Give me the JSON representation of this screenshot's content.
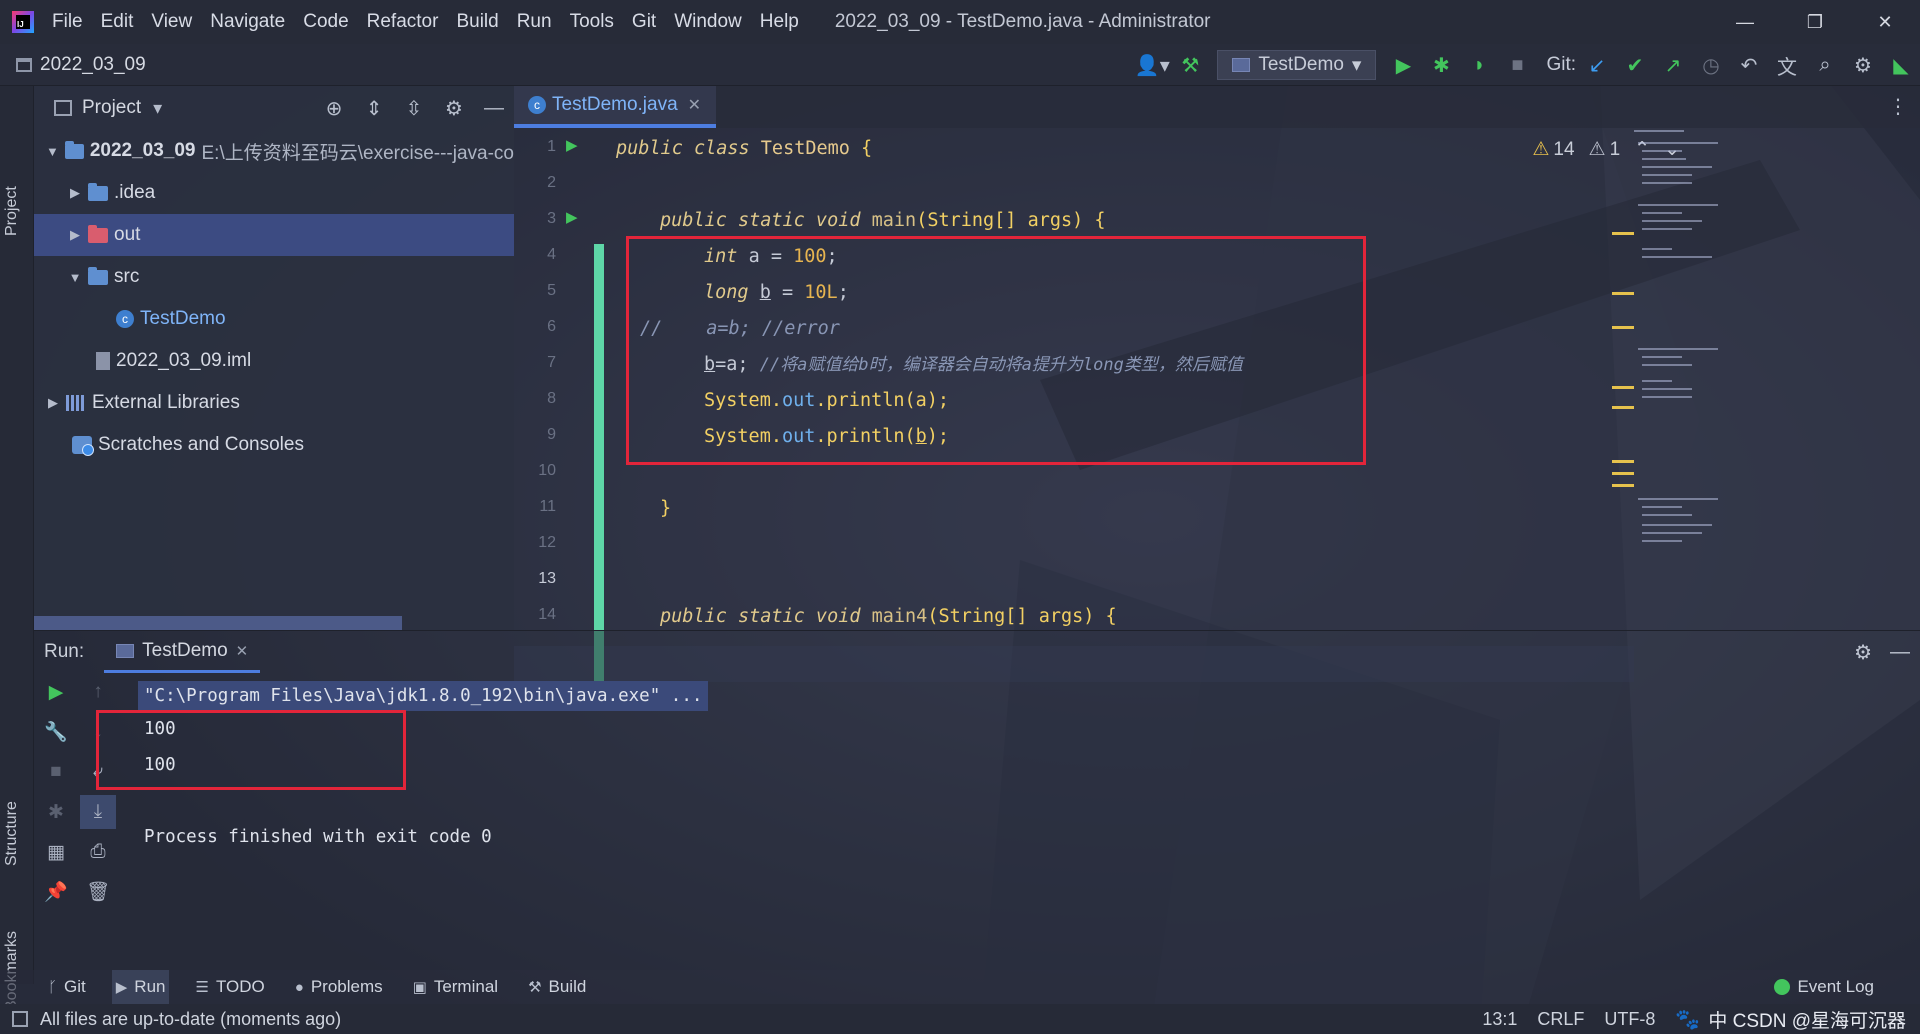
{
  "menubar": {
    "items": [
      "File",
      "Edit",
      "View",
      "Navigate",
      "Code",
      "Refactor",
      "Build",
      "Run",
      "Tools",
      "Git",
      "Window",
      "Help"
    ],
    "window_title": "2022_03_09 - TestDemo.java - Administrator",
    "controls": {
      "minimize": "—",
      "restore": "❐",
      "close": "✕"
    }
  },
  "navbar": {
    "project_name": "2022_03_09",
    "run_config": "TestDemo",
    "git_label": "Git:",
    "icons": [
      "user-icon",
      "hammer-icon",
      "run-icon",
      "debug-icon",
      "coverage-icon",
      "stop-icon",
      "update-icon",
      "commit-icon",
      "push-icon",
      "history-icon",
      "rollback-icon",
      "translate-icon",
      "search-icon",
      "settings-icon",
      "plugin-icon"
    ]
  },
  "left_stripe": {
    "project": "Project",
    "structure": "Structure",
    "bookmarks": "Bookmarks"
  },
  "project_panel": {
    "title": "Project",
    "tree": [
      {
        "label": "2022_03_09",
        "path": "E:\\上传资料至码云\\exercise---java-co",
        "type": "module",
        "expanded": true,
        "depth": 0
      },
      {
        "label": ".idea",
        "type": "folder",
        "expanded": false,
        "depth": 1
      },
      {
        "label": "out",
        "type": "folder-excluded",
        "expanded": false,
        "depth": 1,
        "selected": true
      },
      {
        "label": "src",
        "type": "folder",
        "expanded": true,
        "depth": 1
      },
      {
        "label": "TestDemo",
        "type": "class",
        "depth": 2
      },
      {
        "label": "2022_03_09.iml",
        "type": "file",
        "depth": 1
      },
      {
        "label": "External Libraries",
        "type": "library",
        "expanded": false,
        "depth": 0
      },
      {
        "label": "Scratches and Consoles",
        "type": "scratch",
        "depth": 0
      }
    ]
  },
  "editor": {
    "tab_label": "TestDemo.java",
    "inspections": {
      "warnings": "14",
      "weak_warnings": "1"
    },
    "line_numbers": [
      "1",
      "2",
      "3",
      "4",
      "5",
      "6",
      "7",
      "8",
      "9",
      "10",
      "11",
      "12",
      "13",
      "14"
    ],
    "current_line": "13",
    "code": {
      "l1_kw": "public class ",
      "l1_name": "TestDemo",
      "l1_brace": " {",
      "l3_kw": "public static void ",
      "l3_fn": "main",
      "l3_rest": "(String[] args) {",
      "l4_kw": "int ",
      "l4_var": "a = ",
      "l4_num": "100",
      "l4_end": ";",
      "l5_kw": "long ",
      "l5_var": "b",
      "l5_eq": " = ",
      "l5_num": "10L",
      "l5_end": ";",
      "l6_slash": "//",
      "l6_code": "a=b; //error",
      "l7_var": "b",
      "l7_code": "=a; ",
      "l7_cmt": "//将a赋值给b时，编译器会自动将a提升为long类型，然后赋值",
      "l8_pre": "System.",
      "l8_field": "out",
      "l8_post": ".println(a);",
      "l9_pre": "System.",
      "l9_field": "out",
      "l9_mid": ".println(",
      "l9_var": "b",
      "l9_end": ");",
      "l11": "}",
      "l14_kw": "public static void ",
      "l14_fn": "main4",
      "l14_rest": "(String[] args) {"
    }
  },
  "run_panel": {
    "label": "Run:",
    "tab": "TestDemo",
    "command": "\"C:\\Program Files\\Java\\jdk1.8.0_192\\bin\\java.exe\" ...",
    "output": [
      "100",
      "100"
    ],
    "finished": "Process finished with exit code 0"
  },
  "bottom_tools": {
    "git": "Git",
    "run": "Run",
    "todo": "TODO",
    "problems": "Problems",
    "terminal": "Terminal",
    "build": "Build",
    "event_log": "Event Log"
  },
  "statusbar": {
    "message": "All files are up-to-date (moments ago)",
    "position": "13:1",
    "line_sep": "CRLF",
    "encoding": "UTF-8",
    "watermark": "中 CSDN @星海可沉器"
  },
  "colors": {
    "accent": "#4d7de0",
    "highlight_box": "#e3253a",
    "run_green": "#43c55d",
    "change_bar": "#5ed6a7",
    "warning": "#e7c04d"
  }
}
